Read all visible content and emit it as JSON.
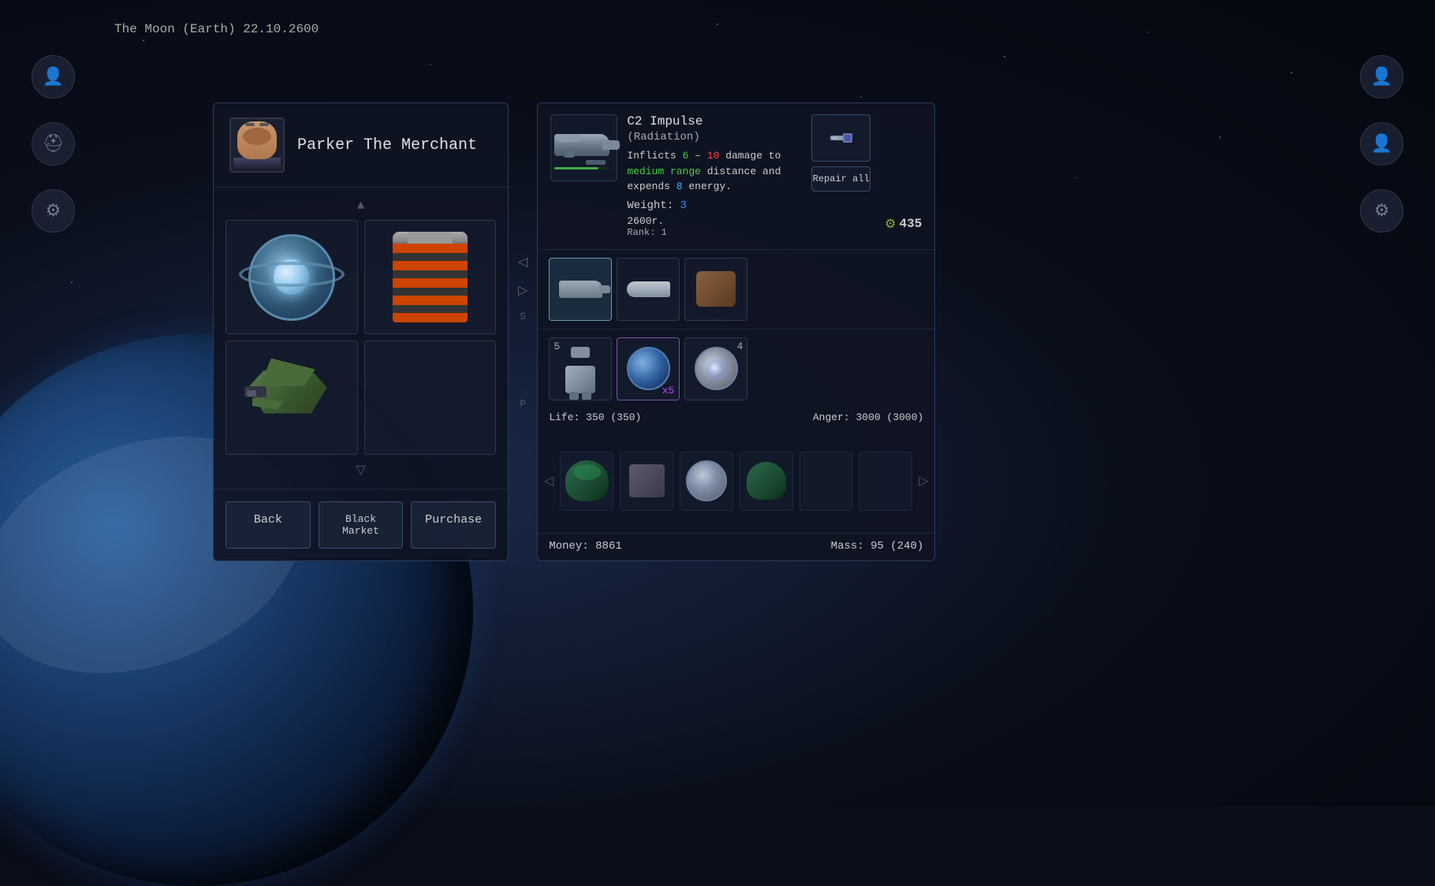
{
  "location": {
    "text": "The Moon (Earth) 22.10.2600"
  },
  "merchant": {
    "name": "Parker The Merchant",
    "title": "Parker The Merchant"
  },
  "buttons": {
    "back": "Back",
    "black_market": "Black Market",
    "purchase": "Purchase",
    "repair_all": "Repair all"
  },
  "selected_item": {
    "name": "C2 Impulse",
    "type": "(Radiation)",
    "description_prefix": "Inflicts",
    "dmg_min": "6",
    "dmg_dash": " – ",
    "dmg_max": "10",
    "description_mid": "damage to",
    "range_text": "medium range",
    "description_suffix": "distance and expends",
    "energy": "8",
    "description_end": "energy.",
    "weight_label": "Weight:",
    "weight_value": "3",
    "price": "2600r.",
    "rank": "Rank: 1",
    "credits_icon": "⚙",
    "credits_amount": "435"
  },
  "stats": {
    "life_label": "Life:",
    "life_value": "350 (350)",
    "x5_label": "x5",
    "anger_label": "Anger:",
    "anger_value": "3000 (3000)"
  },
  "footer": {
    "money_label": "Money:",
    "money_value": "8861",
    "mass_label": "Mass:",
    "mass_value": "95 (240)"
  },
  "inventory_slots": [
    {
      "id": 1,
      "badge": "",
      "selected": true
    },
    {
      "id": 2,
      "badge": "",
      "selected": false
    },
    {
      "id": 3,
      "badge": "",
      "selected": false
    },
    {
      "id": 4,
      "badge": "5",
      "selected": false
    },
    {
      "id": 5,
      "badge": "",
      "selected": false,
      "badge_right": "x5"
    },
    {
      "id": 6,
      "badge": "4",
      "selected": false
    }
  ]
}
